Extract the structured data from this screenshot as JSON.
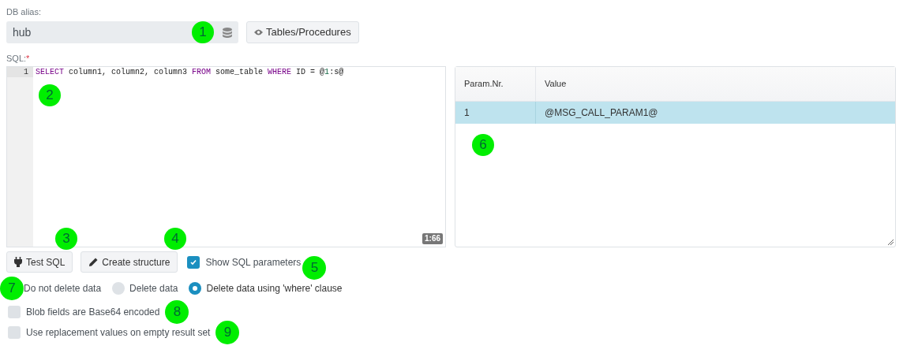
{
  "db_alias": {
    "label": "DB alias:",
    "value": "hub",
    "button": "Tables/Procedures"
  },
  "sql": {
    "label": "SQL:",
    "required_mark": "*",
    "line_number": "1",
    "tokens": [
      {
        "kind": "keyword",
        "text": "SELECT"
      },
      {
        "kind": "plain",
        "text": " column1, column2, column3 "
      },
      {
        "kind": "keyword",
        "text": "FROM"
      },
      {
        "kind": "plain",
        "text": " some_table "
      },
      {
        "kind": "keyword",
        "text": "WHERE"
      },
      {
        "kind": "plain",
        "text": " ID = @"
      },
      {
        "kind": "number",
        "text": "1"
      },
      {
        "kind": "plain",
        "text": ":s@"
      }
    ],
    "cursor_position": "1:66"
  },
  "params_table": {
    "columns": [
      "Param.Nr.",
      "Value"
    ],
    "rows": [
      {
        "cells": [
          "1",
          "@MSG_CALL_PARAM1@"
        ],
        "selected": true
      }
    ]
  },
  "buttons": [
    {
      "kind": "plug",
      "label": "Test SQL"
    },
    {
      "kind": "pencil",
      "label": "Create structure"
    }
  ],
  "show_sql_parameters": {
    "label": "Show SQL parameters",
    "checked": true
  },
  "delete_options": [
    {
      "label": "Do not delete data",
      "selected": false,
      "covered": true
    },
    {
      "label": "Delete data",
      "selected": false,
      "covered": false
    },
    {
      "label": "Delete data using 'where' clause",
      "selected": true,
      "covered": false
    }
  ],
  "checkboxes": [
    {
      "label": "Blob fields are Base64 encoded",
      "checked": false
    },
    {
      "label": "Use replacement values on empty result set",
      "checked": false
    }
  ],
  "annotations": [
    {
      "label": "1"
    },
    {
      "label": "2"
    },
    {
      "label": "3"
    },
    {
      "label": "4"
    },
    {
      "label": "5"
    },
    {
      "label": "6"
    },
    {
      "label": "7"
    },
    {
      "label": "8"
    },
    {
      "label": "9"
    }
  ]
}
